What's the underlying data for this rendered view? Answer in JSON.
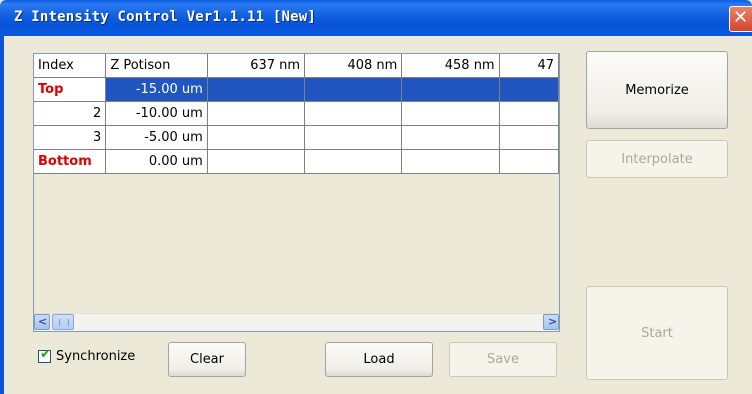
{
  "window": {
    "title": "Z Intensity Control Ver1.1.11 [New]",
    "close_symbol": "✕"
  },
  "grid": {
    "headers": [
      "Index",
      "Z Potison",
      "637  nm",
      "408  nm",
      "458  nm",
      "47"
    ],
    "rows": [
      {
        "index": "Top",
        "index_red": true,
        "zpos": "-15.00  um",
        "selected": true
      },
      {
        "index": "2",
        "index_red": false,
        "zpos": "-10.00  um",
        "selected": false
      },
      {
        "index": "3",
        "index_red": false,
        "zpos": "-5.00  um",
        "selected": false
      },
      {
        "index": "Bottom",
        "index_red": true,
        "zpos": "0.00  um",
        "selected": false
      }
    ],
    "scroll_left": "<",
    "scroll_right": ">"
  },
  "buttons": {
    "memorize": "Memorize",
    "interpolate": "Interpolate",
    "start": "Start",
    "clear": "Clear",
    "load": "Load",
    "save": "Save"
  },
  "synchronize": {
    "label": "Synchronize",
    "checked": true,
    "mark": "✔"
  },
  "colors": {
    "selection": "#2155c0",
    "index_red": "#e00000",
    "titlebar": "#0a5de3"
  }
}
